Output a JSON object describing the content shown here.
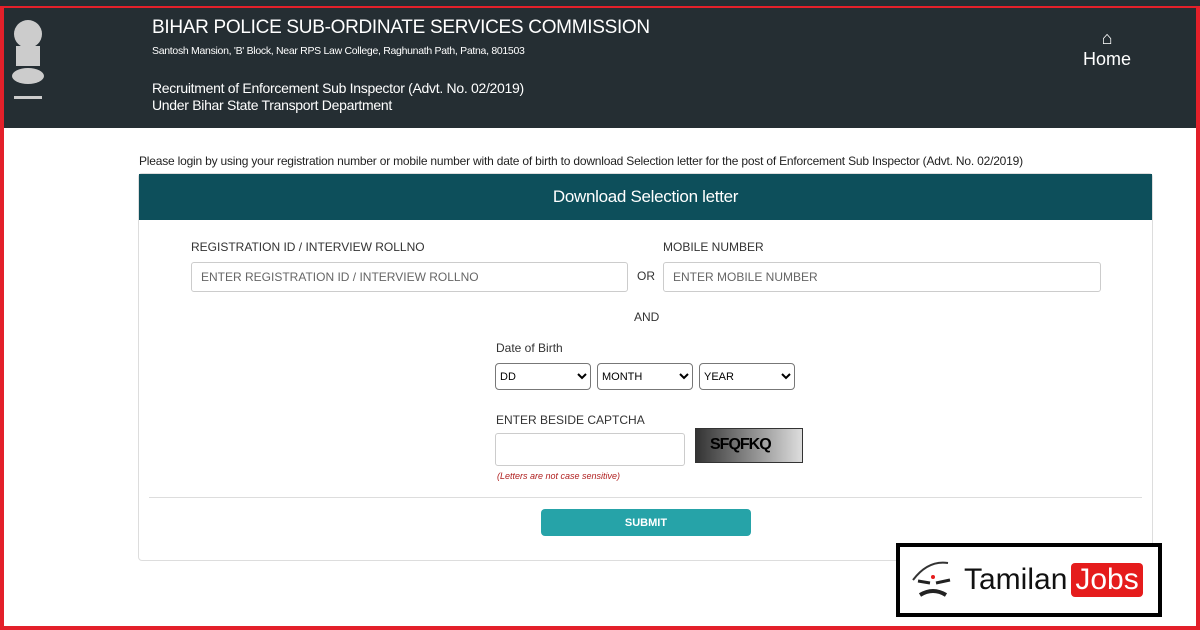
{
  "header": {
    "title": "BIHAR POLICE SUB-ORDINATE SERVICES COMMISSION",
    "address": "Santosh Mansion, 'B' Block, Near RPS Law College, Raghunath Path, Patna, 801503",
    "recruitment": "Recruitment of Enforcement Sub Inspector (Advt. No. 02/2019)",
    "department": "Under Bihar State Transport Department",
    "home_label": "Home"
  },
  "notice": "Please login by using your registration number or mobile number with date of birth to download Selection letter for the post of Enforcement Sub Inspector (Advt. No. 02/2019)",
  "form": {
    "title": "Download Selection letter",
    "reg_label": "REGISTRATION ID / INTERVIEW ROLLNO",
    "reg_placeholder": "ENTER REGISTRATION ID / INTERVIEW ROLLNO",
    "or": "OR",
    "mobile_label": "MOBILE NUMBER",
    "mobile_placeholder": "ENTER MOBILE NUMBER",
    "and": "AND",
    "dob_label": "Date of Birth",
    "dd": "DD",
    "month": "MONTH",
    "year": "YEAR",
    "captcha_label": "ENTER BESIDE CAPTCHA",
    "captcha_text": "SFQFKQ",
    "captcha_hint": "(Letters are not case sensitive)",
    "submit": "SUBMIT"
  },
  "watermark": {
    "text1": "Tamilan",
    "text2": "Jobs"
  },
  "colors": {
    "header": "#252e33",
    "panel_header": "#0d4f5b",
    "submit": "#26a3a8",
    "border": "#e3202a"
  }
}
